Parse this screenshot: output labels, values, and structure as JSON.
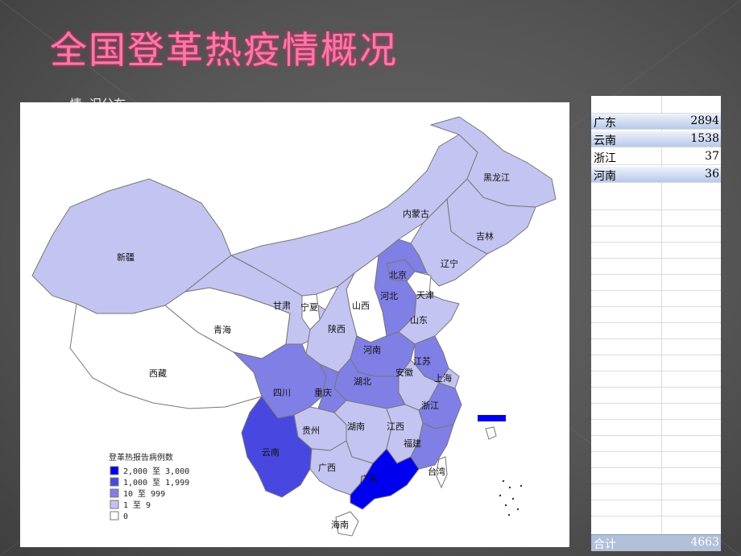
{
  "slide": {
    "title": "全国登革热疫情概况",
    "subtitle": "一、      情  况分布"
  },
  "map": {
    "provinces": {
      "xinjiang": "新疆",
      "xizang": "西藏",
      "qinghai": "青海",
      "gansu": "甘肃",
      "ningxia": "宁夏",
      "neimenggu": "内蒙古",
      "heilongjiang": "黑龙江",
      "jilin": "吉林",
      "liaoning": "辽宁",
      "beijing": "北京",
      "tianjin": "天津",
      "hebei": "河北",
      "shanxi": "山西",
      "shaanxi": "陕西",
      "shandong": "山东",
      "henan": "河南",
      "jiangsu": "江苏",
      "shanghai": "上海",
      "anhui": "安徽",
      "hubei": "湖北",
      "sichuan": "四川",
      "chongqing": "重庆",
      "zhejiang": "浙江",
      "guizhou": "贵州",
      "hunan": "湖南",
      "jiangxi": "江西",
      "fujian": "福建",
      "yunnan": "云南",
      "guangxi": "广西",
      "guangdong": "广东",
      "hainan": "海南",
      "taiwan": "台湾"
    },
    "legend": {
      "title": "登革热报告病例数",
      "items": [
        {
          "label": "2,000 至 3,000",
          "color": "#0000ee"
        },
        {
          "label": "1,000 至 1,999",
          "color": "#4848e0"
        },
        {
          "label": "10 至     999",
          "color": "#7f7fe6"
        },
        {
          "label": "1 至       9",
          "color": "#c4c4f2"
        },
        {
          "label": "0",
          "color": "#ffffff"
        }
      ]
    }
  },
  "sheet": {
    "rows": [
      {
        "province": "广东",
        "count": "2894"
      },
      {
        "province": "云南",
        "count": "1538"
      },
      {
        "province": "浙江",
        "count": "37"
      },
      {
        "province": "河南",
        "count": "36"
      }
    ],
    "total_label": "合计",
    "total_value": "4663",
    "row_count": 26
  },
  "colors": {
    "title": "#f47ba8",
    "level_0": "#ffffff",
    "level_1": "#c4c4f2",
    "level_2": "#7f7fe6",
    "level_3": "#4848e0",
    "level_4": "#0000ee"
  }
}
